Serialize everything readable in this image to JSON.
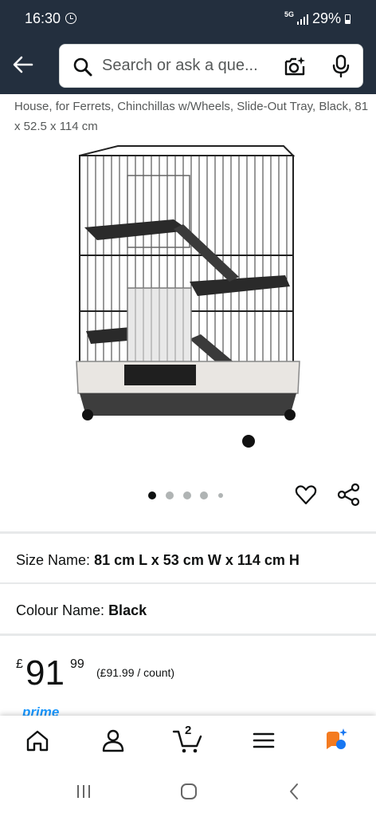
{
  "status_bar": {
    "time": "16:30",
    "network": "5G",
    "battery": "29%"
  },
  "header": {
    "search_placeholder": "Search or ask a que..."
  },
  "product": {
    "title": "House, for Ferrets, Chinchillas w/Wheels, Slide-Out Tray, Black, 81 x 52.5 x 114 cm",
    "image_count": 5,
    "active_image_index": 0
  },
  "size": {
    "label": "Size Name:",
    "value": "81 cm L x 53 cm W x 114 cm H"
  },
  "colour": {
    "label": "Colour Name:",
    "value": "Black"
  },
  "price": {
    "currency": "£",
    "whole": "91",
    "fraction": "99",
    "unit_price": "(£91.99 / count)"
  },
  "prime": {
    "label": "prime"
  },
  "bottom_nav": {
    "cart_count": "2",
    "items": [
      "home-icon",
      "account-icon",
      "cart-icon",
      "menu-icon",
      "rufus-ai-icon"
    ]
  },
  "colors": {
    "header_bg": "#232f3e",
    "prime_blue": "#1a98ff",
    "rufus_orange": "#f47b20",
    "rufus_blue": "#1877f2"
  }
}
